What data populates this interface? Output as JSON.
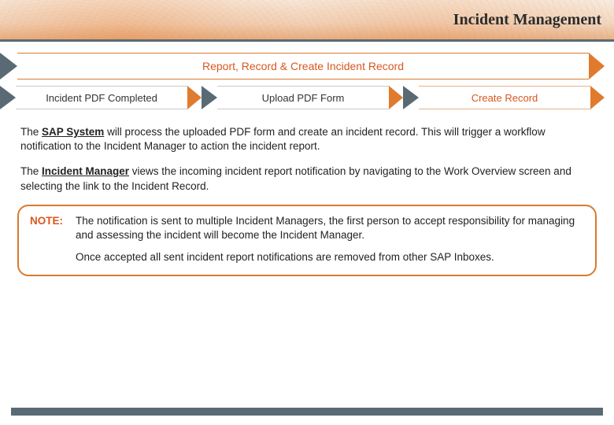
{
  "header": {
    "title": "Incident Management"
  },
  "banner": {
    "label": "Report, Record & Create Incident Record"
  },
  "steps": [
    {
      "label": "Incident PDF Completed"
    },
    {
      "label": "Upload PDF Form"
    },
    {
      "label": "Create Record"
    }
  ],
  "body": {
    "p1_a": "The ",
    "p1_b": "SAP System",
    "p1_c": " will process the uploaded PDF form and create an incident record. This will trigger a workflow notification to the Incident Manager to action the incident report.",
    "p2_a": "The ",
    "p2_b": "Incident Manager",
    "p2_c": " views the incoming incident report notification by navigating to the Work Overview screen and selecting the link to the Incident Record."
  },
  "note": {
    "label": "NOTE:",
    "line1": "The notification is sent to multiple Incident Managers, the first person to accept responsibility for managing and assessing the incident will become the Incident Manager.",
    "line2": "Once accepted all sent incident report notifications are removed from other SAP Inboxes."
  }
}
